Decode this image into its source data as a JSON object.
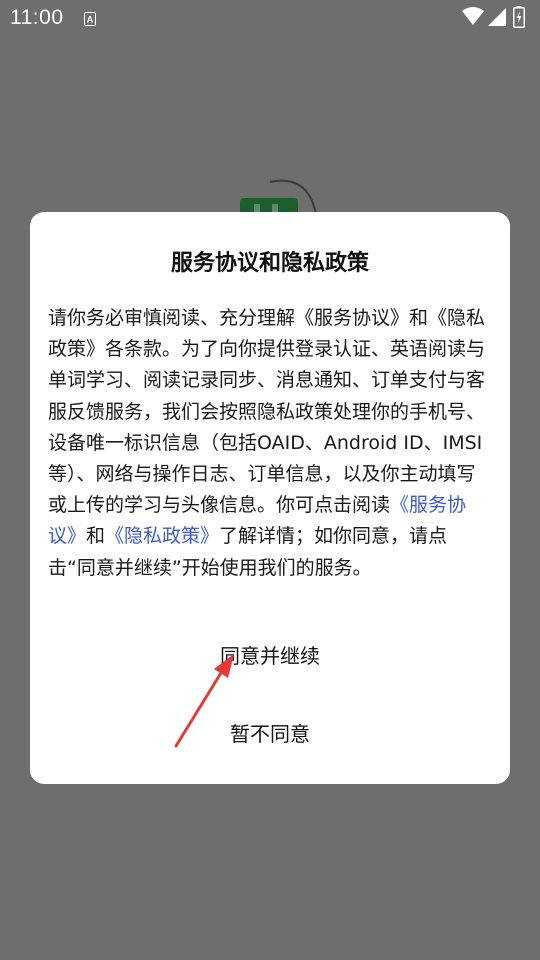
{
  "status_bar": {
    "time": "11:00",
    "notification_icon": "font-a-icon",
    "wifi_icon": "wifi-icon",
    "signal_icon": "signal-icon",
    "battery_icon": "battery-charging-icon"
  },
  "dialog": {
    "title": "服务协议和隐私政策",
    "body_part1": "请你务必审慎阅读、充分理解《服务协议》和《隐私政策》各条款。为了向你提供登录认证、英语阅读与单词学习、阅读记录同步、消息通知、订单支付与客服反馈服务，我们会按照隐私政策处理你的手机号、设备唯一标识信息（包括OAID、Android ID、IMSI 等）、网络与操作日志、订单信息，以及你主动填写或上传的学习与头像信息。你可点击阅读",
    "link_service": "《服务协议》",
    "body_and": "和",
    "link_privacy": "《隐私政策》",
    "body_part2": "了解详情；如你同意，请点击“同意并继续”开始使用我们的服务。",
    "agree_label": "同意并继续",
    "decline_label": "暂不同意"
  },
  "colors": {
    "overlay": "#6e6e6e",
    "link": "#3b5bd6",
    "arrow": "#e53935"
  }
}
